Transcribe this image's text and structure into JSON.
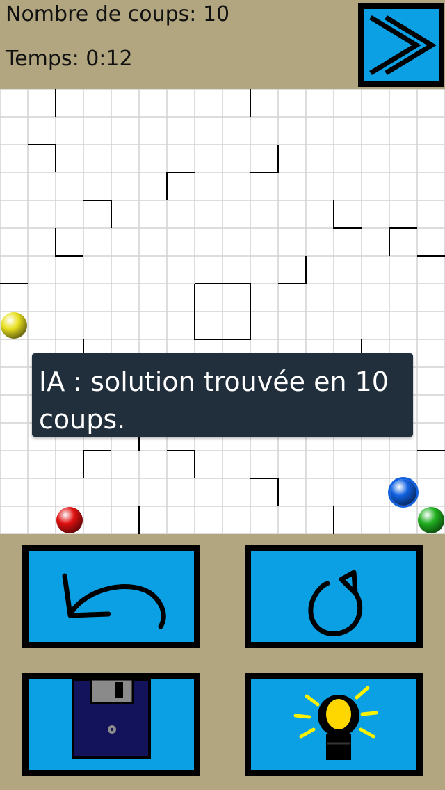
{
  "hud": {
    "moves_text": "Nombre de coups: 10",
    "time_text": "Temps: 0:12"
  },
  "toast": {
    "message": "IA : solution trouvée en 10 coups."
  },
  "board": {
    "grid_cells": 16,
    "robots": [
      {
        "color_name": "yellow",
        "color": "#e8e020",
        "row": 8,
        "col": 0
      },
      {
        "color_name": "red",
        "color": "#e01010",
        "row": 15,
        "col": 2
      },
      {
        "color_name": "blue",
        "color": "#1060e0",
        "row": 14,
        "col": 14,
        "selected": true
      },
      {
        "color_name": "green",
        "color": "#20b020",
        "row": 15,
        "col": 15
      }
    ]
  },
  "buttons": {
    "next": {
      "icon": "double-chevron-right-icon"
    },
    "undo": {
      "icon": "undo-arrow-icon"
    },
    "restart": {
      "icon": "restart-icon"
    },
    "save": {
      "icon": "floppy-disk-icon"
    },
    "hint": {
      "icon": "lightbulb-icon"
    }
  },
  "colors": {
    "background": "#b1a67f",
    "button_fill": "#0ba0e3",
    "button_border": "#000000",
    "toast_background": "#212e3c"
  }
}
